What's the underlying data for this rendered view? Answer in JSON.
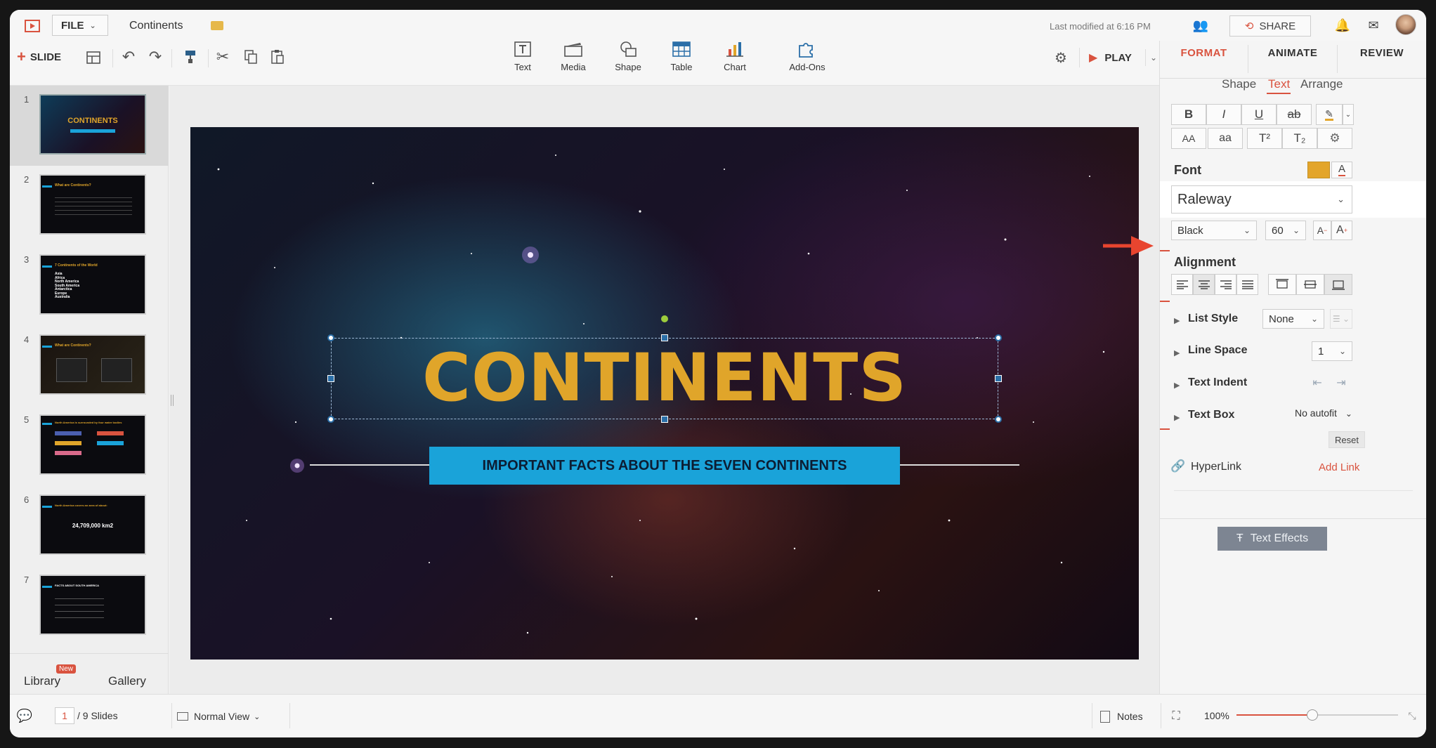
{
  "header": {
    "file_label": "FILE",
    "doc_title": "Continents",
    "last_modified": "Last modified at 6:16 PM",
    "share_label": "SHARE"
  },
  "toolbar": {
    "slide_label": "SLIDE",
    "insert_items": [
      "Text",
      "Media",
      "Shape",
      "Table",
      "Chart",
      "Add-Ons"
    ],
    "play_label": "PLAY"
  },
  "panel_tabs": [
    "FORMAT",
    "ANIMATE",
    "REVIEW"
  ],
  "sub_tabs": [
    "Shape",
    "Text",
    "Arrange"
  ],
  "text_buttons": [
    "B",
    "I",
    "U",
    "ab",
    "AA",
    "aa",
    "T²",
    "T₂"
  ],
  "font": {
    "section": "Font",
    "family": "Raleway",
    "weight": "Black",
    "size": "60"
  },
  "alignment_section": "Alignment",
  "options": {
    "list_style_label": "List Style",
    "list_style_value": "None",
    "line_space_label": "Line Space",
    "line_space_value": "1",
    "text_indent_label": "Text Indent",
    "text_box_label": "Text Box",
    "text_box_value": "No autofit",
    "reset_label": "Reset",
    "hyperlink_label": "HyperLink",
    "add_link_label": "Add Link",
    "text_effects_label": "Text Effects"
  },
  "slide": {
    "title": "CONTINENTS",
    "subtitle": "IMPORTANT FACTS ABOUT THE SEVEN CONTINENTS"
  },
  "thumbnails": [
    {
      "num": "1",
      "title": "CONTINENTS"
    },
    {
      "num": "2",
      "title": "What are Continents?"
    },
    {
      "num": "3",
      "title": "7 Continents of the World"
    },
    {
      "num": "4",
      "title": "What are Continents?"
    },
    {
      "num": "5",
      "title": "North America is surrounded by four water bodies"
    },
    {
      "num": "6",
      "title": "North America covers an area of about:",
      "value": "24,709,000 km2"
    },
    {
      "num": "7",
      "title": "FACTS ABOUT SOUTH AMERICA"
    }
  ],
  "slide3_list": [
    "Asia",
    "Africa",
    "North America",
    "South America",
    "Antarctica",
    "Europe",
    "Australia"
  ],
  "sidebar_bottom": {
    "library_label": "Library",
    "new_badge": "New",
    "gallery_label": "Gallery"
  },
  "status": {
    "current_slide": "1",
    "total_slides": "/ 9 Slides",
    "view_mode": "Normal View",
    "notes_label": "Notes",
    "zoom": "100%",
    "zoom_fraction": 0.47
  },
  "colors": {
    "accent_red": "#d9533f",
    "title_gold": "#e0a52a",
    "subtitle_bg": "#1aa3d9",
    "font_color_swatch": "#e3a52b"
  }
}
